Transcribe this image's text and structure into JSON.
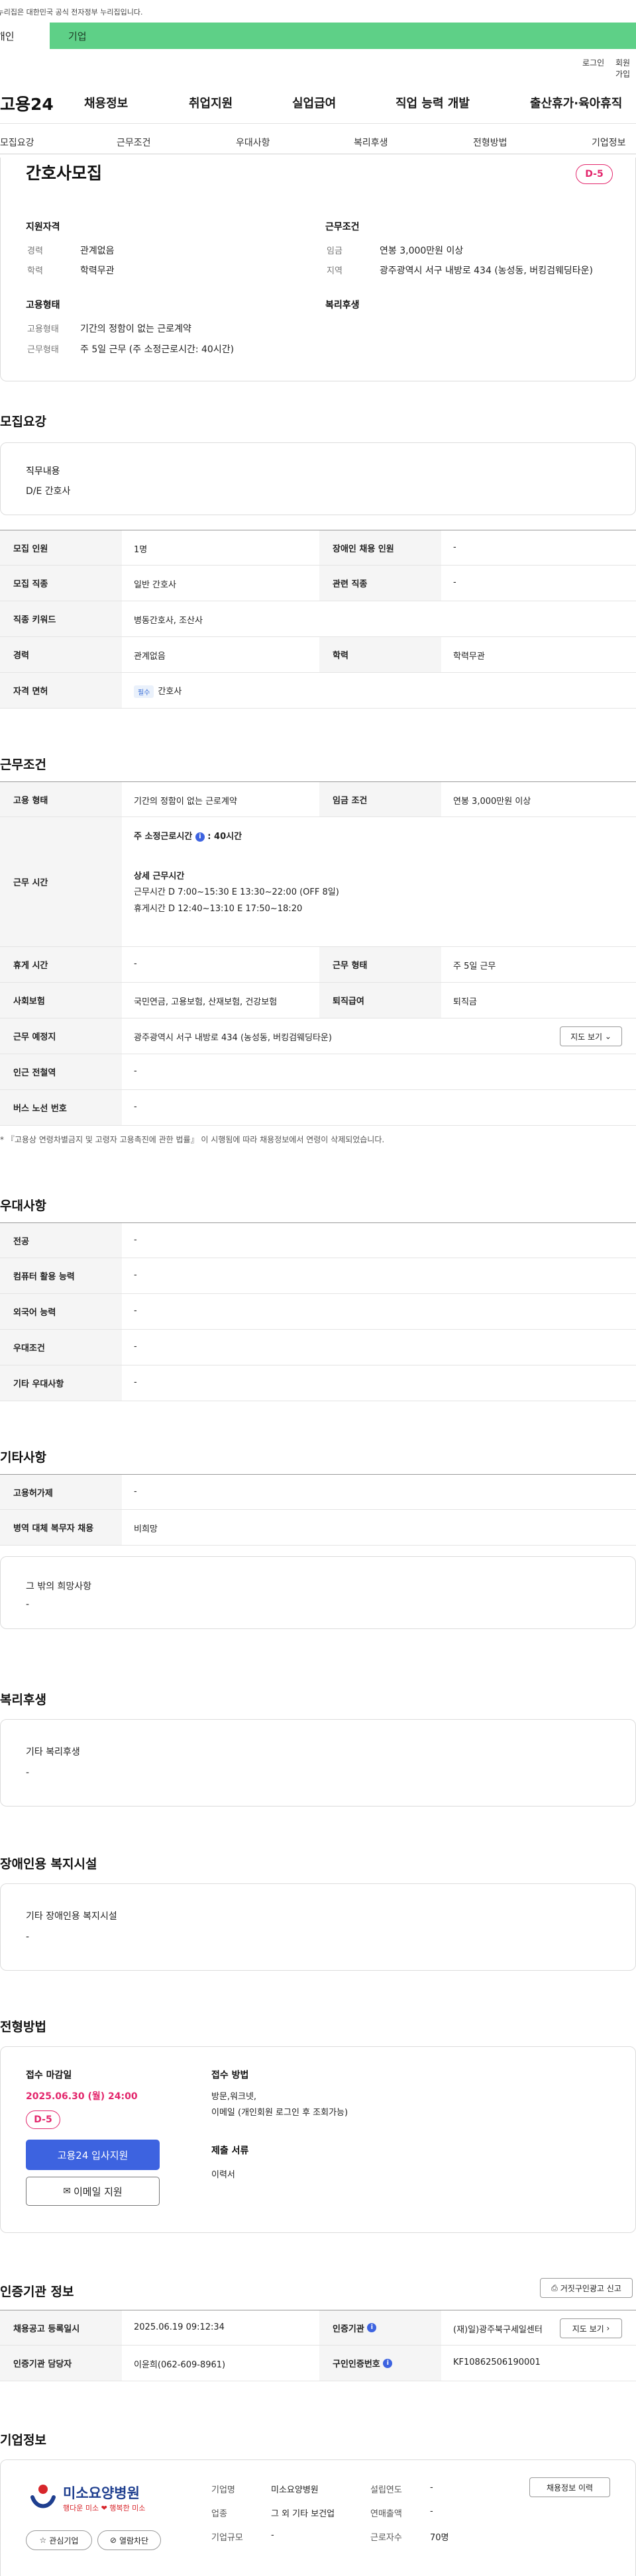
{
  "banner": {
    "text": "이 누리집은 대한민국 공식 전자정부 누리집입니다."
  },
  "user_tabs": {
    "personal": "개인",
    "corporate": "기업"
  },
  "util": {
    "login": "로그인",
    "signup": "회원가입"
  },
  "gnb": {
    "logo": "고용24",
    "menu": [
      "채용정보",
      "취업지원",
      "실업급여",
      "직업 능력 개발",
      "출산휴가·육아휴직"
    ]
  },
  "subnav": [
    "모집요강",
    "근무조건",
    "우대사항",
    "복리후생",
    "전형방법",
    "기업정보"
  ],
  "summary": {
    "title": "간호사모집",
    "dday": "D-5",
    "qual_title": "지원자격",
    "qual": [
      {
        "k": "경력",
        "v": "관계없음"
      },
      {
        "k": "학력",
        "v": "학력무관"
      }
    ],
    "cond_title": "근무조건",
    "cond": [
      {
        "k": "임금",
        "v": "연봉 3,000만원 이상"
      },
      {
        "k": "지역",
        "v": "광주광역시 서구 내방로 434 (농성동, 버킹검웨딩타운)"
      }
    ],
    "emp_title": "고용형태",
    "emp": [
      {
        "k": "고용형태",
        "v": "기간의 정함이 없는 근로계약"
      },
      {
        "k": "근무형태",
        "v": "주 5일 근무 (주 소정근로시간: 40시간)"
      }
    ],
    "welfare_title": "복리후생"
  },
  "recruit": {
    "title": "모집요강",
    "duty_label": "직무내용",
    "duty_value": "D/E 간호사",
    "rows": {
      "count_k": "모집 인원",
      "count_v": "1명",
      "disabled_k": "장애인 채용 인원",
      "disabled_v": "-",
      "job_k": "모집 직종",
      "job_v": "일반 간호사",
      "rel_k": "관련 직종",
      "rel_v": "-",
      "kw_k": "직종 키워드",
      "kw_v": "병동간호사, 조산사",
      "career_k": "경력",
      "career_v": "관계없음",
      "edu_k": "학력",
      "edu_v": "학력무관",
      "license_k": "자격 면허",
      "license_tag": "필수",
      "license_v": "간호사"
    }
  },
  "work": {
    "title": "근무조건",
    "type_k": "고용 형태",
    "type_v": "기간의 정함이 없는 근로계약",
    "wage_k": "임금 조건",
    "wage_v": "연봉 3,000만원 이상",
    "hours_k": "근무 시간",
    "hours_weekly_label": "주 소정근로시간",
    "hours_weekly_val": "40시간",
    "hours_detail_label": "상세 근무시간",
    "hours_detail_1": "근무시간 D 7:00~15:30 E 13:30~22:00 (OFF 8일)",
    "hours_detail_2": "휴게시간 D 12:40~13:10 E 17:50~18:20",
    "rest_k": "휴게 시간",
    "rest_v": "-",
    "form_k": "근무 형태",
    "form_v": "주 5일 근무",
    "ins_k": "사회보험",
    "ins_v": "국민연금, 고용보험, 산재보험, 건강보험",
    "sev_k": "퇴직급여",
    "sev_v": "퇴직금",
    "place_k": "근무 예정지",
    "place_v": "광주광역시 서구 내방로 434 (농성동, 버킹검웨딩타운)",
    "map_btn": "지도 보기",
    "subway_k": "인근 전철역",
    "subway_v": "-",
    "bus_k": "버스 노선 번호",
    "bus_v": "-",
    "note": "* 『고용상 연령차별금지 및 고령자 고용촉진에 관한 법률』 이 시행됨에 따라 채용정보에서 연령이 삭제되었습니다."
  },
  "pref": {
    "title": "우대사항",
    "rows": [
      {
        "k": "전공",
        "v": "-"
      },
      {
        "k": "컴퓨터 활용 능력",
        "v": "-"
      },
      {
        "k": "외국어 능력",
        "v": "-"
      },
      {
        "k": "우대조건",
        "v": "-"
      },
      {
        "k": "기타 우대사항",
        "v": "-"
      }
    ]
  },
  "etc": {
    "title": "기타사항",
    "rows": [
      {
        "k": "고용허가제",
        "v": "-"
      },
      {
        "k": "병역 대체 복무자 채용",
        "v": "비희망"
      }
    ],
    "box_label": "그 밖의 희망사항",
    "box_value": "-"
  },
  "welfare": {
    "title": "복리후생",
    "box_label": "기타 복리후생",
    "box_value": "-"
  },
  "disab": {
    "title": "장애인용 복지시설",
    "box_label": "기타 장애인용 복지시설",
    "box_value": "-"
  },
  "selection": {
    "title": "전형방법",
    "deadline_label": "접수 마감일",
    "deadline": "2025.06.30 (월) 24:00",
    "dday": "D-5",
    "apply_btn": "고용24 입사지원",
    "email_btn": "이메일 지원",
    "method_label": "접수 방법",
    "method_v1": "방문,워크넷,",
    "method_v2": "이메일 (개인회원 로그인 후 조회가능)",
    "docs_label": "제출 서류",
    "docs_v": "이력서"
  },
  "cert": {
    "title": "인증기관 정보",
    "report_btn": "거짓구인광고 신고",
    "reg_k": "채용공고 등록일시",
    "reg_v": "2025.06.19 09:12:34",
    "org_k": "인증기관",
    "org_v": "(재)일)광주북구세일센터",
    "map_btn": "지도 보기",
    "mgr_k": "인증기관 담당자",
    "mgr_v": "이윤희(062-609-8961)",
    "no_k": "구인인증번호",
    "no_v": "KF10862506190001"
  },
  "company": {
    "title": "기업정보",
    "logo_name": "미소요양병원",
    "logo_slogan": "행다운 미소 ❤ 행복한 미소",
    "fav_btn": "관심기업",
    "block_btn": "열람차단",
    "history_btn": "채용정보 이력",
    "rows": [
      {
        "k": "기업명",
        "v": "미소요양병원"
      },
      {
        "k": "업종",
        "v": "그 외 기타 보건업"
      },
      {
        "k": "기업규모",
        "v": "-"
      }
    ],
    "rows2": [
      {
        "k": "설립연도",
        "v": "-"
      },
      {
        "k": "연매출액",
        "v": "-"
      },
      {
        "k": "근로자수",
        "v": "70명"
      }
    ]
  },
  "colors": {
    "accent": "#3d63e0",
    "dday": "#e3266c",
    "corp_tab": "#5ed087"
  }
}
